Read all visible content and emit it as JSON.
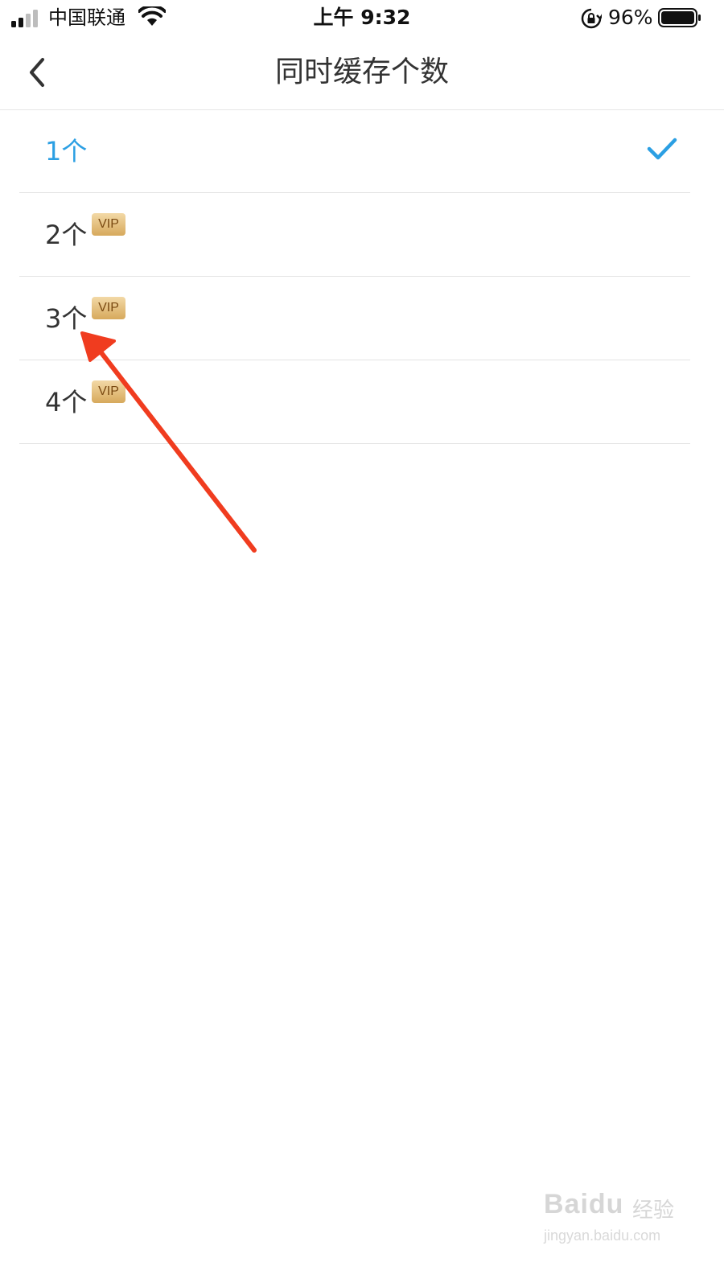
{
  "status_bar": {
    "carrier": "中国联通",
    "time": "上午 9:32",
    "battery": "96%"
  },
  "nav": {
    "title": "同时缓存个数"
  },
  "options": [
    {
      "label": "1个",
      "selected": true,
      "vip": false
    },
    {
      "label": "2个",
      "selected": false,
      "vip": true,
      "badge": "VIP"
    },
    {
      "label": "3个",
      "selected": false,
      "vip": true,
      "badge": "VIP"
    },
    {
      "label": "4个",
      "selected": false,
      "vip": true,
      "badge": "VIP"
    }
  ],
  "watermark": {
    "logo": "Baidu",
    "brand": "经验",
    "url": "jingyan.baidu.com"
  },
  "colors": {
    "accent": "#2b9fe3",
    "text": "#333333",
    "divider": "#e3e3e3",
    "vip_gold": "#d7a95c",
    "annotation": "#f03c1f"
  },
  "icons": {
    "back": "chevron-left-icon",
    "selected": "check-icon",
    "signal": "cellular-signal-icon",
    "wifi": "wifi-icon",
    "rotation_lock": "rotation-lock-icon",
    "battery": "battery-icon"
  }
}
